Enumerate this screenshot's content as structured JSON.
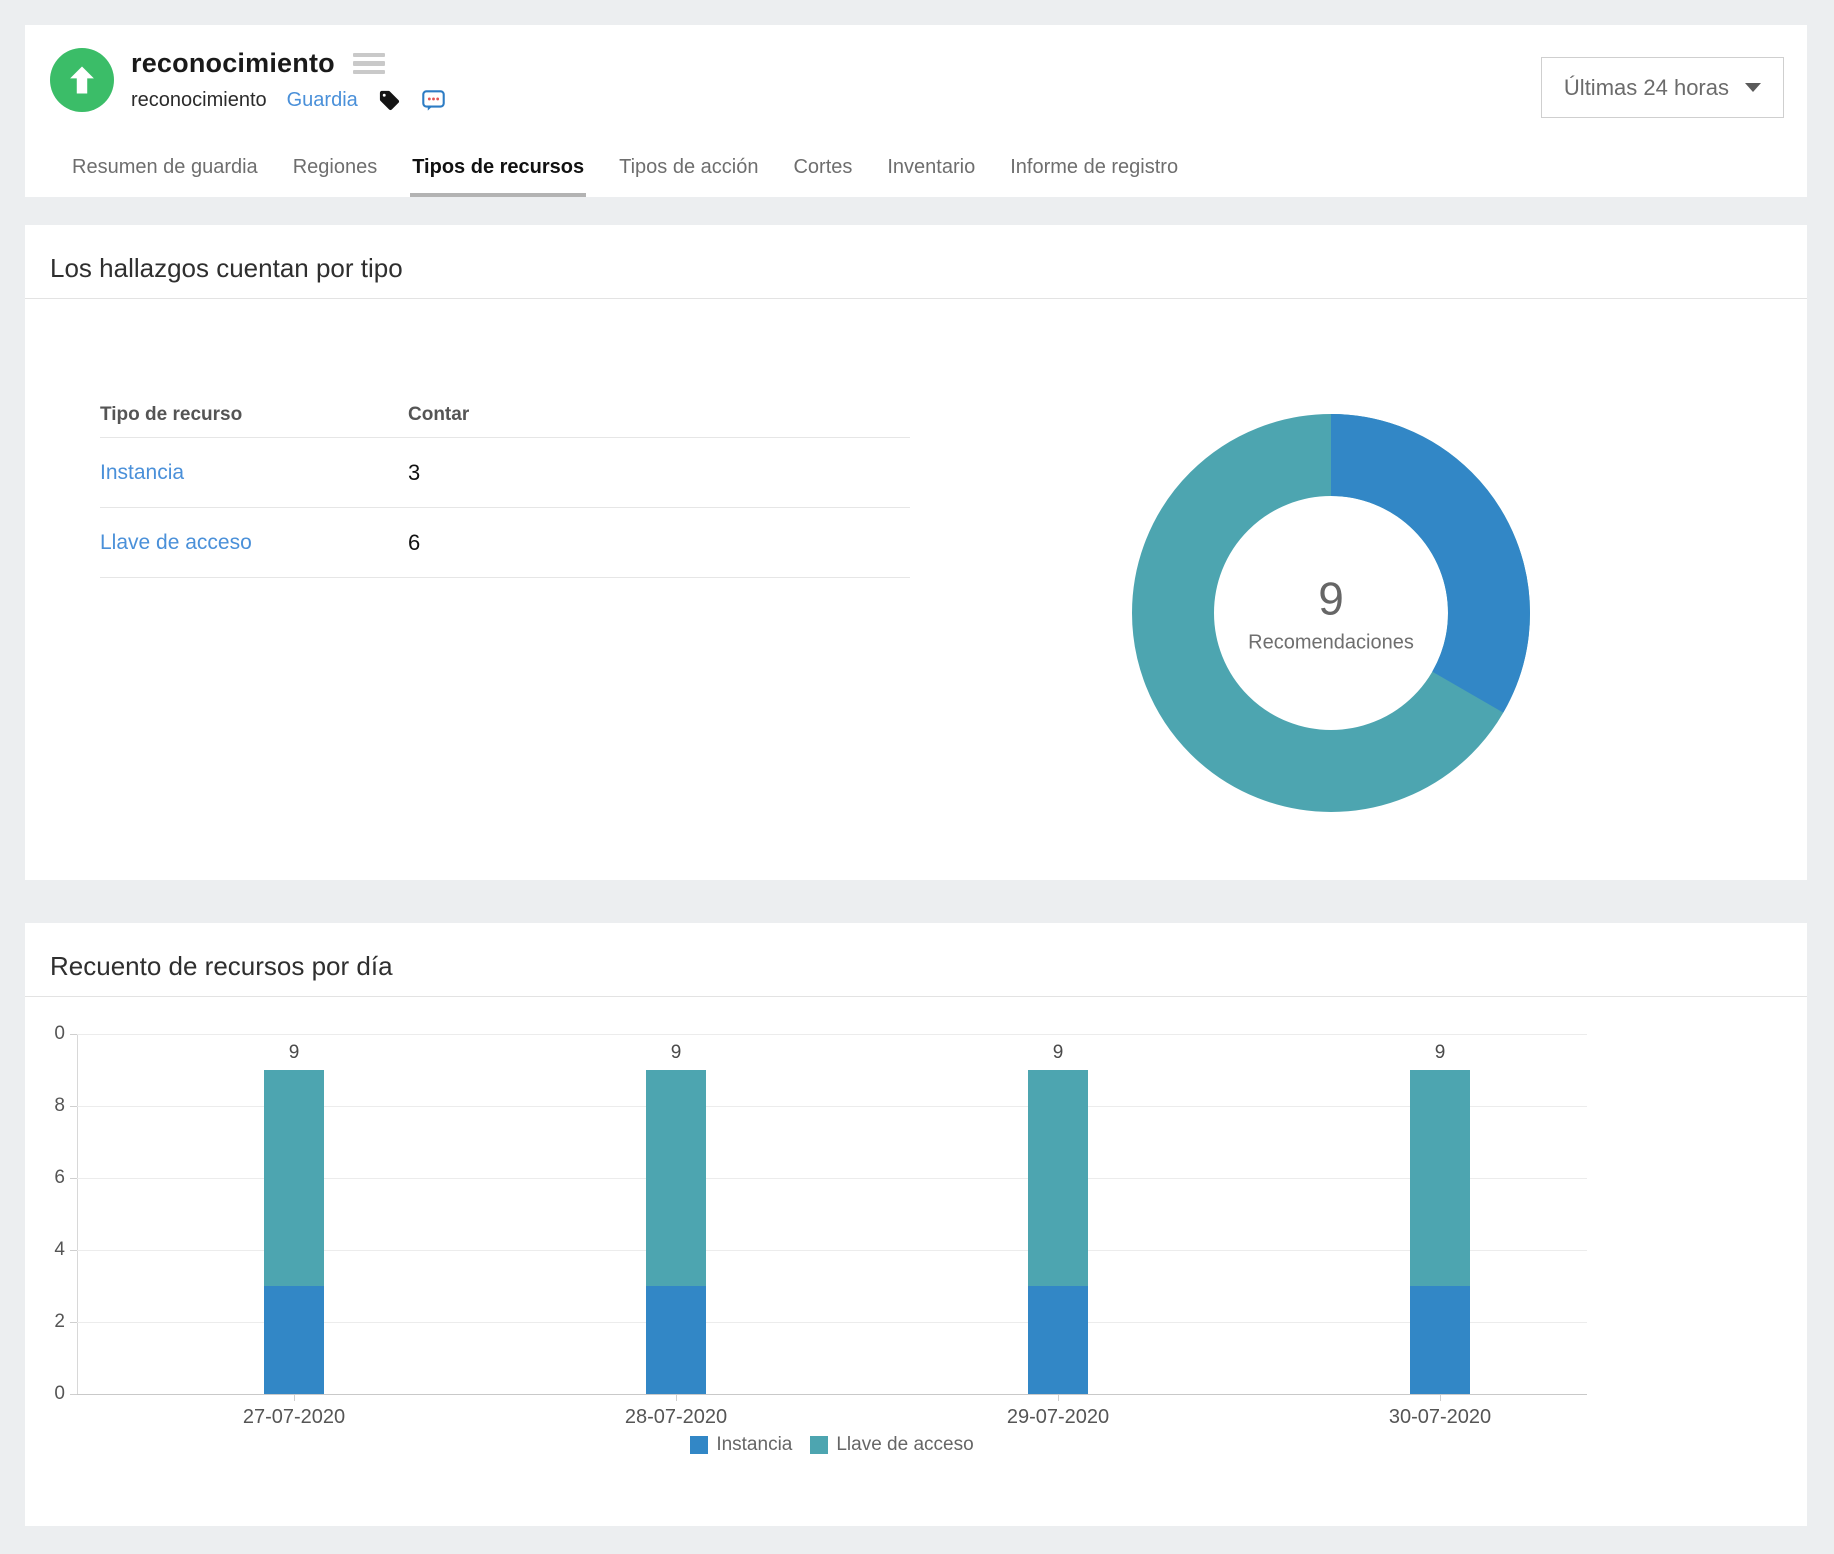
{
  "header": {
    "title": "reconocimiento",
    "subtitle": "reconocimiento",
    "subtitle_link": "Guardia",
    "time_range_label": "Últimas 24 horas",
    "tabs": [
      {
        "label": "Resumen de guardia",
        "active": false
      },
      {
        "label": "Regiones",
        "active": false
      },
      {
        "label": "Tipos de recursos",
        "active": true
      },
      {
        "label": "Tipos de acción",
        "active": false
      },
      {
        "label": "Cortes",
        "active": false
      },
      {
        "label": "Inventario",
        "active": false
      },
      {
        "label": "Informe de registro",
        "active": false
      }
    ]
  },
  "findings_card": {
    "title": "Los hallazgos cuentan por tipo",
    "table": {
      "columns": [
        "Tipo de recurso",
        "Contar"
      ],
      "rows": [
        {
          "label": "Instancia",
          "count": "3"
        },
        {
          "label": "Llave de acceso",
          "count": "6"
        }
      ]
    }
  },
  "daily_card": {
    "title": "Recuento de recursos por día"
  },
  "chart_data": [
    {
      "type": "pie",
      "subtype": "donut",
      "title": "Los hallazgos cuentan por tipo",
      "labels": [
        "Instancia",
        "Llave de acceso"
      ],
      "values": [
        3,
        6
      ],
      "colors": [
        "#3287c6",
        "#4da5b0"
      ],
      "center_text": "9",
      "center_label": "Recomendaciones",
      "start_angle": "top",
      "direction": "clockwise"
    },
    {
      "type": "bar",
      "stacked": true,
      "title": "Recuento de recursos por día",
      "categories": [
        "27-07-2020",
        "28-07-2020",
        "29-07-2020",
        "30-07-2020"
      ],
      "series": [
        {
          "name": "Instancia",
          "values": [
            3,
            3,
            3,
            3
          ],
          "color": "#3287c6"
        },
        {
          "name": "Llave de acceso",
          "values": [
            6,
            6,
            6,
            6
          ],
          "color": "#4da5b0"
        }
      ],
      "bar_total_labels": [
        "9",
        "9",
        "9",
        "9"
      ],
      "ylim": [
        0,
        10
      ],
      "y_tick_labels_top_to_bottom": [
        "0",
        "8",
        "6",
        "4",
        "2",
        "0"
      ],
      "grid": true,
      "legend_position": "bottom"
    }
  ],
  "colors": {
    "chart_blue": "#3287c6",
    "chart_teal": "#4da5b0",
    "avatar_green": "#3bbd68",
    "link_blue": "#4a90d9",
    "icon_blue": "#2d7cc4",
    "dot_red": "#e25555"
  }
}
